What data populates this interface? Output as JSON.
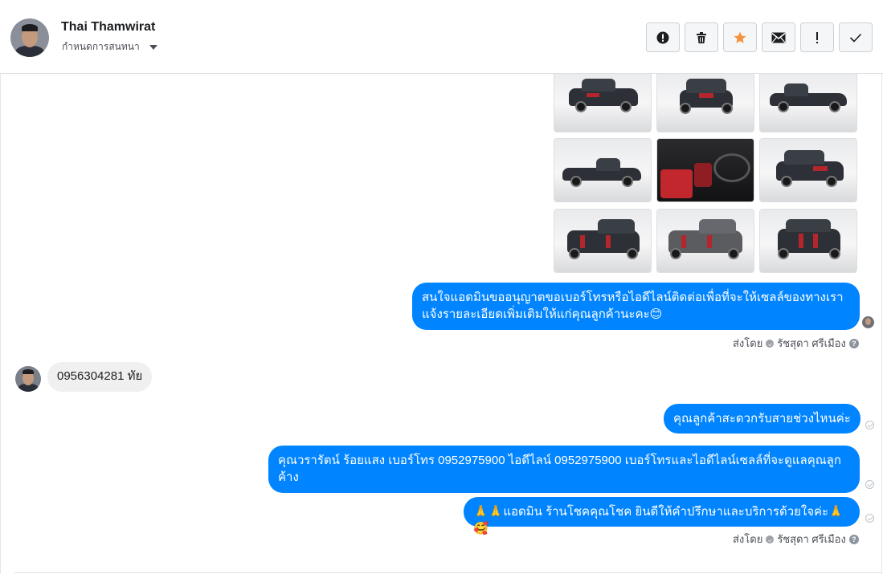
{
  "header": {
    "contact_name": "Thai Thamwirat",
    "assign_label": "กำหนดการสนทนา",
    "tools": [
      {
        "name": "mark-spam",
        "icon": "exclamation-circle-icon"
      },
      {
        "name": "delete",
        "icon": "trash-icon"
      },
      {
        "name": "star",
        "icon": "star-icon",
        "color": "#f5a623"
      },
      {
        "name": "mark-unread",
        "icon": "envelope-icon"
      },
      {
        "name": "follow-up",
        "icon": "exclamation-icon"
      },
      {
        "name": "mark-done",
        "icon": "check-icon"
      }
    ]
  },
  "thread": {
    "photos": [
      {
        "kind": "front-3q"
      },
      {
        "kind": "front"
      },
      {
        "kind": "side-right"
      },
      {
        "kind": "side-left"
      },
      {
        "kind": "interior"
      },
      {
        "kind": "front-3q"
      },
      {
        "kind": "rear-3q"
      },
      {
        "kind": "rear-3q"
      },
      {
        "kind": "rear"
      }
    ],
    "messages": [
      {
        "id": "m1",
        "direction": "out",
        "text": "สนใจแอดมินขออนุญาตขอเบอร์โทรหรือไอดีไลน์ติดต่อเพื่อที่จะให้เซลล์ของทางเรา แจ้งรายละเอียดเพิ่มเติมให้แก่คุณลูกค้านะคะ😊"
      },
      {
        "id": "m2",
        "direction": "in",
        "text": "0956304281 ทัย"
      },
      {
        "id": "m3",
        "direction": "out",
        "text": "คุณลูกค้าสะดวกรับสายช่วงไหนค่ะ"
      },
      {
        "id": "m4",
        "direction": "out",
        "text": "คุณวรารัตน์ ร้อยแสง        เบอร์โทร 0952975900  ไอดีไลน์ 0952975900   เบอร์โทรและไอดีไลน์เซลล์ที่จะดูแลคุณลูกค้าง"
      },
      {
        "id": "m5",
        "direction": "out",
        "text": "🙏🙏แอดมิน ร้านโชคคุณโชค ยินดีให้คำปรึกษาและบริการด้วยใจค่ะ🙏🥰"
      }
    ],
    "sent_by_prefix": "ส่งโดย",
    "sent_by_name": "รัชสุดา ศรีเมือง",
    "sent_by_help": "?"
  }
}
